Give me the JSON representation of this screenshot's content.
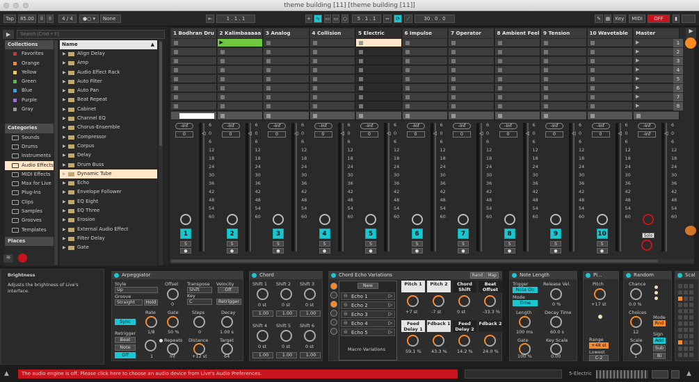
{
  "window": {
    "title": "theme building [11]  [theme building [11]]"
  },
  "control": {
    "tap": "Tap",
    "tempo": "85.00",
    "sig": "4 / 4",
    "rec": "1 Bar",
    "quant": "None",
    "pos": "1 . 1 . 1",
    "loop_start": "5 . 1 . 1",
    "loop_len": "30 . 0 . 0",
    "key": "Key",
    "midi": "MIDI",
    "off": "OFF",
    "cpu": "3 %"
  },
  "browser": {
    "search_placeholder": "Search (Cmd + F)",
    "collections_label": "Collections",
    "collections": [
      {
        "label": "Favorites",
        "color": "#e02d2d"
      },
      {
        "label": "Orange",
        "color": "#ff8a24"
      },
      {
        "label": "Yellow",
        "color": "#f0d23c"
      },
      {
        "label": "Green",
        "color": "#4cc63c"
      },
      {
        "label": "Blue",
        "color": "#3ca0e6"
      },
      {
        "label": "Purple",
        "color": "#a66be6"
      },
      {
        "label": "Gray",
        "color": "#9a9a9a"
      }
    ],
    "categories_label": "Categories",
    "categories": [
      "Sounds",
      "Drums",
      "Instruments",
      "Audio Effects",
      "MIDI Effects",
      "Max for Live",
      "Plug-Ins",
      "Clips",
      "Samples",
      "Grooves",
      "Templates"
    ],
    "selected_category": "Audio Effects",
    "places_label": "Places",
    "name_header": "Name",
    "items": [
      "Align Delay",
      "Amp",
      "Audio Effect Rack",
      "Auto Filter",
      "Auto Pan",
      "Beat Repeat",
      "Cabinet",
      "Channel EQ",
      "Chorus-Ensemble",
      "Compressor",
      "Corpus",
      "Delay",
      "Drum Buss",
      "Dynamic Tube",
      "Echo",
      "Envelope Follower",
      "EQ Eight",
      "EQ Three",
      "Erosion",
      "External Audio Effect",
      "Filter Delay",
      "Gate"
    ],
    "selected_item": "Dynamic Tube"
  },
  "tracks": [
    {
      "name": "1 Bodhran Dru",
      "num": "1"
    },
    {
      "name": "2 Kalimbaaaaa",
      "num": "2"
    },
    {
      "name": "3 Analog",
      "num": "3"
    },
    {
      "name": "4 Collision",
      "num": "4"
    },
    {
      "name": "5 Electric",
      "num": "5"
    },
    {
      "name": "6 Impulse",
      "num": "6"
    },
    {
      "name": "7 Operator",
      "num": "7"
    },
    {
      "name": "8 Ambient Feelin",
      "num": "8"
    },
    {
      "name": "9 Tension",
      "num": "9"
    },
    {
      "name": "10 Wavetable",
      "num": "10"
    }
  ],
  "master": {
    "name": "Master",
    "solo": "Solo",
    "scenes": [
      "1",
      "2",
      "3",
      "4",
      "5",
      "6",
      "7",
      "8"
    ]
  },
  "mixer": {
    "inf": "-Inf",
    "zero": "0",
    "scale": [
      "6",
      "0",
      "6",
      "12",
      "18",
      "24",
      "30",
      "36",
      "42",
      "48",
      "54",
      "60"
    ],
    "solo_btn": "S"
  },
  "info": {
    "title": "Brightness",
    "desc": "Adjusts the brightness of Live's interface."
  },
  "arp": {
    "title": "Arpeggiator",
    "style_l": "Style",
    "style": "Up",
    "groove_l": "Groove",
    "groove": "Straight",
    "hold": "Hold",
    "offset_l": "Offset",
    "offset": "0",
    "rate_l": "Rate",
    "rate": "1/8",
    "gate_l": "Gate",
    "gate": "50 %",
    "sync": "Sync",
    "retrig_l": "Retrigger",
    "beat": "Beat",
    "note": "Note",
    "off": "Off",
    "repeats_l": "Repeats",
    "repeats": "inf",
    "one": "1",
    "transpose_l": "Transpose",
    "transpose": "Shift",
    "key_l": "Key",
    "key": "C",
    "steps_l": "Steps",
    "steps": "0",
    "distance_l": "Distance",
    "distance": "+12 st",
    "velocity_l": "Velocity",
    "velocity": "Off",
    "retrigger": "Retrigger",
    "decay_l": "Decay",
    "decay": "1.00 s",
    "target_l": "Target",
    "target": "64"
  },
  "chord": {
    "title": "Chord",
    "shifts": [
      "Shift 1",
      "Shift 2",
      "Shift 3",
      "Shift 4",
      "Shift 5",
      "Shift 6"
    ],
    "st": "0 st",
    "vel": "1.00"
  },
  "echo": {
    "title": "Chord Echo Variations",
    "rand": "Rand",
    "map": "Map",
    "new": "New",
    "echoes": [
      "Echo 1",
      "Echo 2",
      "Echo 3",
      "Echo 4",
      "Echo 5"
    ],
    "macro": "Macro Variations",
    "macros": [
      {
        "l": "Pitch 1",
        "v": "+7 st"
      },
      {
        "l": "Pitch 2",
        "v": "-7 st"
      },
      {
        "l": "Chord Shift",
        "v": "0 st"
      },
      {
        "l": "Beat Offset",
        "v": "-33.3 %"
      },
      {
        "l": "Feed Delay 1",
        "v": "59.1 %"
      },
      {
        "l": "Fdback 1",
        "v": "43.3 %"
      },
      {
        "l": "Feed Delay 2",
        "v": "14.2 %"
      },
      {
        "l": "Fdback 2",
        "v": "24.0 %"
      }
    ]
  },
  "notelen": {
    "title": "Note Length",
    "trigger_l": "Trigger",
    "trigger": "Note On",
    "mode_l": "Mode",
    "mode": "Time",
    "length_l": "Length",
    "length": "100 ms",
    "gate_l": "Gate",
    "gate": "100 %",
    "release_l": "Release Vel.",
    "release": "0 %",
    "decay_l": "Decay Time",
    "decay": "60.0 s",
    "keyscale_l": "Key Scale",
    "keyscale": "0.00"
  },
  "pitch": {
    "title": "Pi...",
    "pitch_l": "Pitch",
    "pitch": "+17 st",
    "range_l": "Range",
    "range": "+48 st",
    "lowest_l": "Lowest",
    "lowest": "C-2"
  },
  "random": {
    "title": "Random",
    "chance_l": "Chance",
    "chance": "0.0 %",
    "choices_l": "Choices",
    "choices": "12",
    "scale_l": "Scale",
    "scale": "1",
    "mode_l": "Mode",
    "mode": "Rnd",
    "sign_l": "Sign",
    "add": "Add",
    "sub": "Sub",
    "bi": "Bi"
  },
  "scale": {
    "title": "Scal"
  },
  "status": {
    "warning": "The audio engine is off. Please click here to choose an audio device from Live's Audio Preferences.",
    "track": "5-Electric"
  }
}
